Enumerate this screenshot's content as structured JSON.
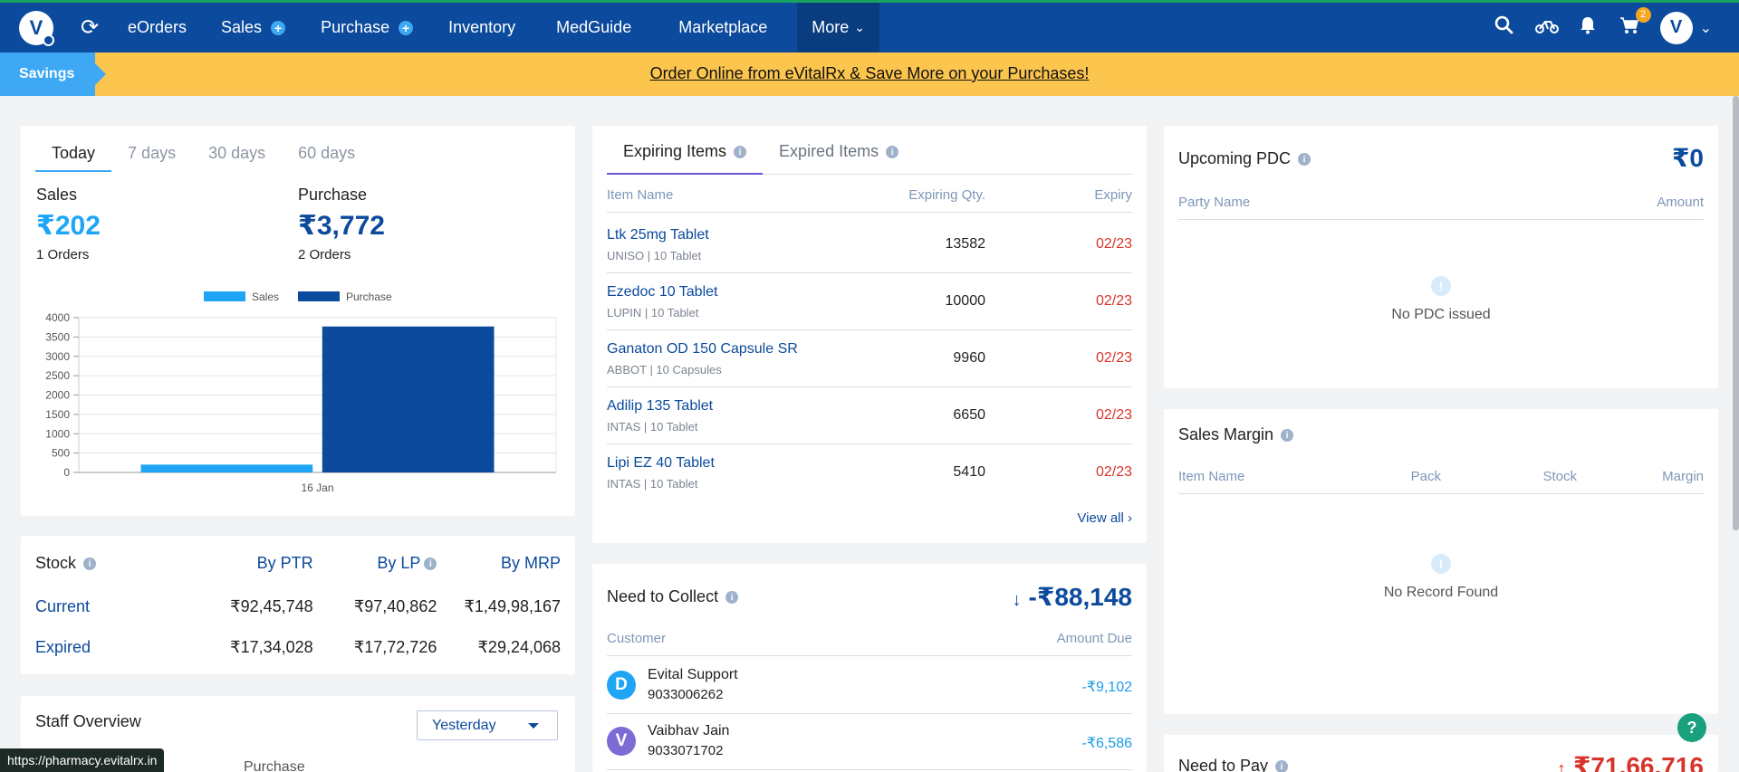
{
  "nav": {
    "logo_letter": "V",
    "items": [
      "eOrders",
      "Sales",
      "Purchase",
      "Inventory",
      "MedGuide",
      "Marketplace"
    ],
    "more_label": "More",
    "cart_count": "2",
    "avatar_letter": "V",
    "plus": "+"
  },
  "savings": {
    "tag": "Savings",
    "link": "Order Online from eVitalRx & Save More on your Purchases!"
  },
  "sales_card": {
    "tabs": [
      "Today",
      "7 days",
      "30 days",
      "60 days"
    ],
    "active_tab": "Today",
    "sales_label": "Sales",
    "sales_value": "₹202",
    "sales_orders": "1 Orders",
    "purchase_label": "Purchase",
    "purchase_value": "₹3,772",
    "purchase_orders": "2 Orders"
  },
  "chart_data": {
    "type": "bar",
    "categories": [
      "16 Jan"
    ],
    "series": [
      {
        "name": "Sales",
        "values": [
          202
        ],
        "color": "#1ea5f5"
      },
      {
        "name": "Purchase",
        "values": [
          3772
        ],
        "color": "#0b4a9c"
      }
    ],
    "ylim": [
      0,
      4000
    ],
    "yticks": [
      "4000",
      "3500",
      "3000",
      "2500",
      "2000",
      "1500",
      "1000",
      "500",
      "0"
    ],
    "legend": "top-center",
    "grid": true
  },
  "stock": {
    "title": "Stock",
    "headers": [
      "By PTR",
      "By LP",
      "By MRP"
    ],
    "rows": [
      {
        "label": "Current",
        "values": [
          "₹92,45,748",
          "₹97,40,862",
          "₹1,49,98,167"
        ]
      },
      {
        "label": "Expired",
        "values": [
          "₹17,34,028",
          "₹17,72,726",
          "₹29,24,068"
        ]
      }
    ]
  },
  "staff": {
    "title": "Staff Overview",
    "period": "Yesterday",
    "partial_header": "Purchase"
  },
  "expiring": {
    "tab_active": "Expiring Items",
    "tab_other": "Expired Items",
    "headers": [
      "Item Name",
      "Expiring Qty.",
      "Expiry"
    ],
    "items": [
      {
        "name": "Ltk 25mg Tablet",
        "mfr": "UNISO | 10 Tablet",
        "qty": "13582",
        "expiry": "02/23"
      },
      {
        "name": "Ezedoc 10 Tablet",
        "mfr": "LUPIN | 10 Tablet",
        "qty": "10000",
        "expiry": "02/23"
      },
      {
        "name": "Ganaton OD 150 Capsule SR",
        "mfr": "ABBOT | 10 Capsules",
        "qty": "9960",
        "expiry": "02/23"
      },
      {
        "name": "Adilip 135 Tablet",
        "mfr": "INTAS | 10 Tablet",
        "qty": "6650",
        "expiry": "02/23"
      },
      {
        "name": "Lipi EZ 40 Tablet",
        "mfr": "INTAS | 10 Tablet",
        "qty": "5410",
        "expiry": "02/23"
      }
    ],
    "view_all": "View all"
  },
  "collect": {
    "title": "Need to Collect",
    "total": "-₹88,148",
    "headers": [
      "Customer",
      "Amount Due"
    ],
    "rows": [
      {
        "initial": "D",
        "name": "Evital Support",
        "phone": "9033006262",
        "amount": "-₹9,102",
        "color": "#1ea5f5"
      },
      {
        "initial": "V",
        "name": "Vaibhav Jain",
        "phone": "9033071702",
        "amount": "-₹6,586",
        "color": "#7d6bd6"
      }
    ]
  },
  "pdc": {
    "title": "Upcoming PDC",
    "amount": "₹0",
    "headers": [
      "Party Name",
      "Amount"
    ],
    "empty": "No PDC issued"
  },
  "margin": {
    "title": "Sales Margin",
    "headers": [
      "Item Name",
      "Pack",
      "Stock",
      "Margin"
    ],
    "empty": "No Record Found"
  },
  "pay": {
    "title": "Need to Pay",
    "amount": "₹71,66,716"
  },
  "status_url": "https://pharmacy.evitalrx.in",
  "help": "?"
}
